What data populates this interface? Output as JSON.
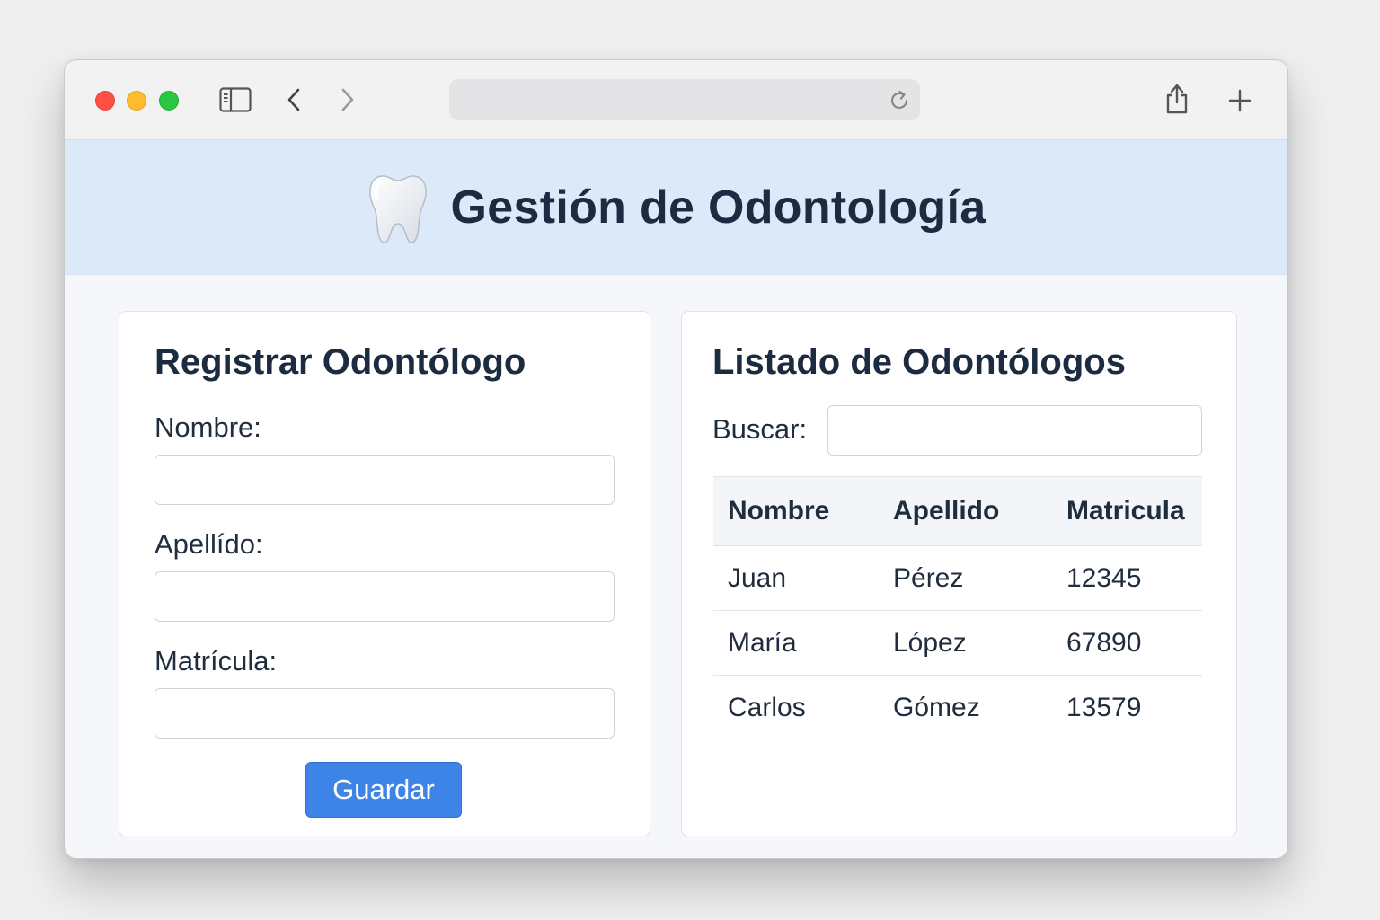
{
  "app": {
    "title": "Gestión de Odontología",
    "icon": "tooth-icon"
  },
  "browser": {
    "address_value": "",
    "icons": [
      "sidebar-icon",
      "back-arrow-icon",
      "forward-arrow-icon",
      "reload-icon",
      "share-icon",
      "new-tab-icon"
    ]
  },
  "register": {
    "title": "Registrar Odontólogo",
    "fields": [
      {
        "label": "Nombre:",
        "value": ""
      },
      {
        "label": "Apellído:",
        "value": ""
      },
      {
        "label": "Matrícula:",
        "value": ""
      }
    ],
    "save_label": "Guardar"
  },
  "listing": {
    "title": "Listado de Odontólogos",
    "search_label": "Buscar:",
    "search_value": "",
    "columns": [
      "Nombre",
      "Apellido",
      "Matricula"
    ],
    "rows": [
      [
        "Juan",
        "Pérez",
        "12345"
      ],
      [
        "María",
        "López",
        "67890"
      ],
      [
        "Carlos",
        "Gómez",
        "13579"
      ]
    ]
  },
  "colors": {
    "header_bg": "#dbe9f9",
    "accent": "#3d84e6",
    "title_text": "#1c2b40"
  }
}
